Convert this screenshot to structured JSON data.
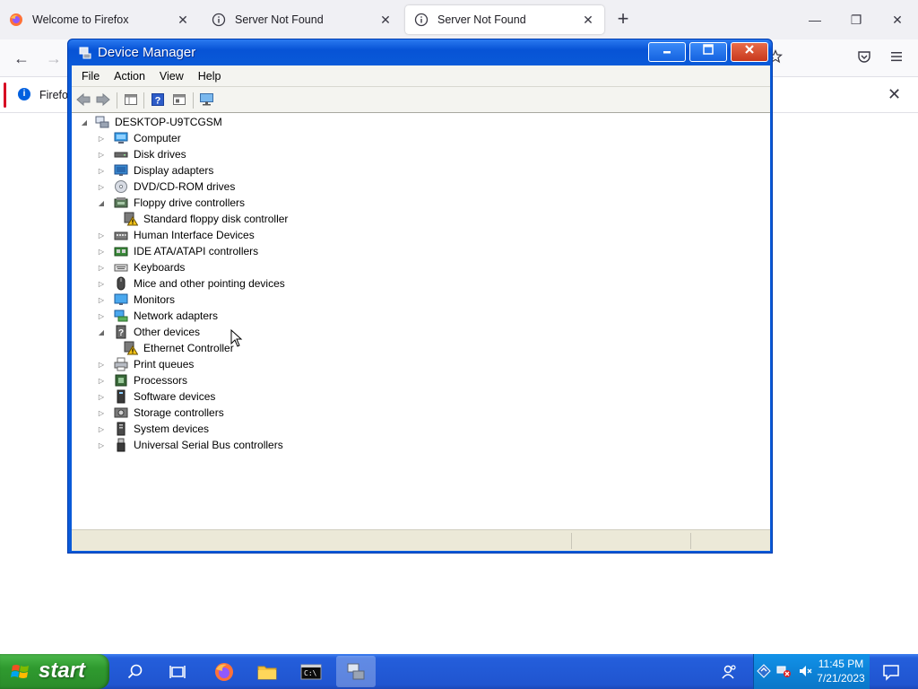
{
  "browser": {
    "tabs": [
      {
        "title": "Welcome to Firefox",
        "active": false,
        "icon": "firefox-icon"
      },
      {
        "title": "Server Not Found",
        "active": false,
        "icon": "info-icon"
      },
      {
        "title": "Server Not Found",
        "active": true,
        "icon": "info-icon"
      }
    ],
    "new_tab_label": "+",
    "window_controls": {
      "minimize": "—",
      "restore": "❐",
      "close": "✕"
    },
    "nav": {
      "back": "←",
      "forward": "→"
    },
    "notice": {
      "text": "Firefox",
      "close": "✕"
    }
  },
  "device_manager": {
    "title": "Device Manager",
    "title_buttons": {
      "minimize": "—",
      "maximize": "□",
      "close": "✕"
    },
    "menu": [
      "File",
      "Action",
      "View",
      "Help"
    ],
    "toolbar": [
      "back-icon",
      "forward-icon",
      "properties-grid-icon",
      "help-icon",
      "details-pane-icon",
      "scan-hardware-icon"
    ],
    "tree": {
      "root": "DESKTOP-U9TCGSM",
      "categories": [
        {
          "label": "Computer",
          "expanded": false,
          "icon": "computer-icon"
        },
        {
          "label": "Disk drives",
          "expanded": false,
          "icon": "disk-drive-icon"
        },
        {
          "label": "Display adapters",
          "expanded": false,
          "icon": "display-adapter-icon"
        },
        {
          "label": "DVD/CD-ROM drives",
          "expanded": false,
          "icon": "dvd-drive-icon"
        },
        {
          "label": "Floppy drive controllers",
          "expanded": true,
          "icon": "floppy-controller-icon",
          "children": [
            {
              "label": "Standard floppy disk controller",
              "icon": "warning-device-icon"
            }
          ]
        },
        {
          "label": "Human Interface Devices",
          "expanded": false,
          "icon": "hid-icon"
        },
        {
          "label": "IDE ATA/ATAPI controllers",
          "expanded": false,
          "icon": "ide-controller-icon"
        },
        {
          "label": "Keyboards",
          "expanded": false,
          "icon": "keyboard-icon"
        },
        {
          "label": "Mice and other pointing devices",
          "expanded": false,
          "icon": "mouse-icon"
        },
        {
          "label": "Monitors",
          "expanded": false,
          "icon": "monitor-icon"
        },
        {
          "label": "Network adapters",
          "expanded": false,
          "icon": "network-adapter-icon"
        },
        {
          "label": "Other devices",
          "expanded": true,
          "icon": "unknown-device-icon",
          "children": [
            {
              "label": "Ethernet Controller",
              "icon": "warning-device-icon"
            }
          ]
        },
        {
          "label": "Print queues",
          "expanded": false,
          "icon": "printer-icon"
        },
        {
          "label": "Processors",
          "expanded": false,
          "icon": "processor-icon"
        },
        {
          "label": "Software devices",
          "expanded": false,
          "icon": "software-device-icon"
        },
        {
          "label": "Storage controllers",
          "expanded": false,
          "icon": "storage-controller-icon"
        },
        {
          "label": "System devices",
          "expanded": false,
          "icon": "system-device-icon"
        },
        {
          "label": "Universal Serial Bus controllers",
          "expanded": false,
          "icon": "usb-icon"
        }
      ]
    }
  },
  "taskbar": {
    "start_label": "start",
    "apps": [
      "search-icon",
      "task-view-icon",
      "firefox-icon",
      "file-explorer-icon",
      "command-prompt-icon",
      "device-manager-icon"
    ],
    "active_app": "device-manager-icon",
    "tray": [
      "people-icon",
      "network-icon",
      "network-error-icon",
      "volume-muted-icon"
    ],
    "clock": {
      "time": "11:45 PM",
      "date": "7/21/2023"
    }
  },
  "colors": {
    "xp_blue": "#0a5ad8",
    "taskbar_blue": "#245edb",
    "start_green": "#2f9a2f",
    "tray_blue": "#0d83d8",
    "close_red": "#c8381c",
    "firefox_accent": "#0060df"
  }
}
